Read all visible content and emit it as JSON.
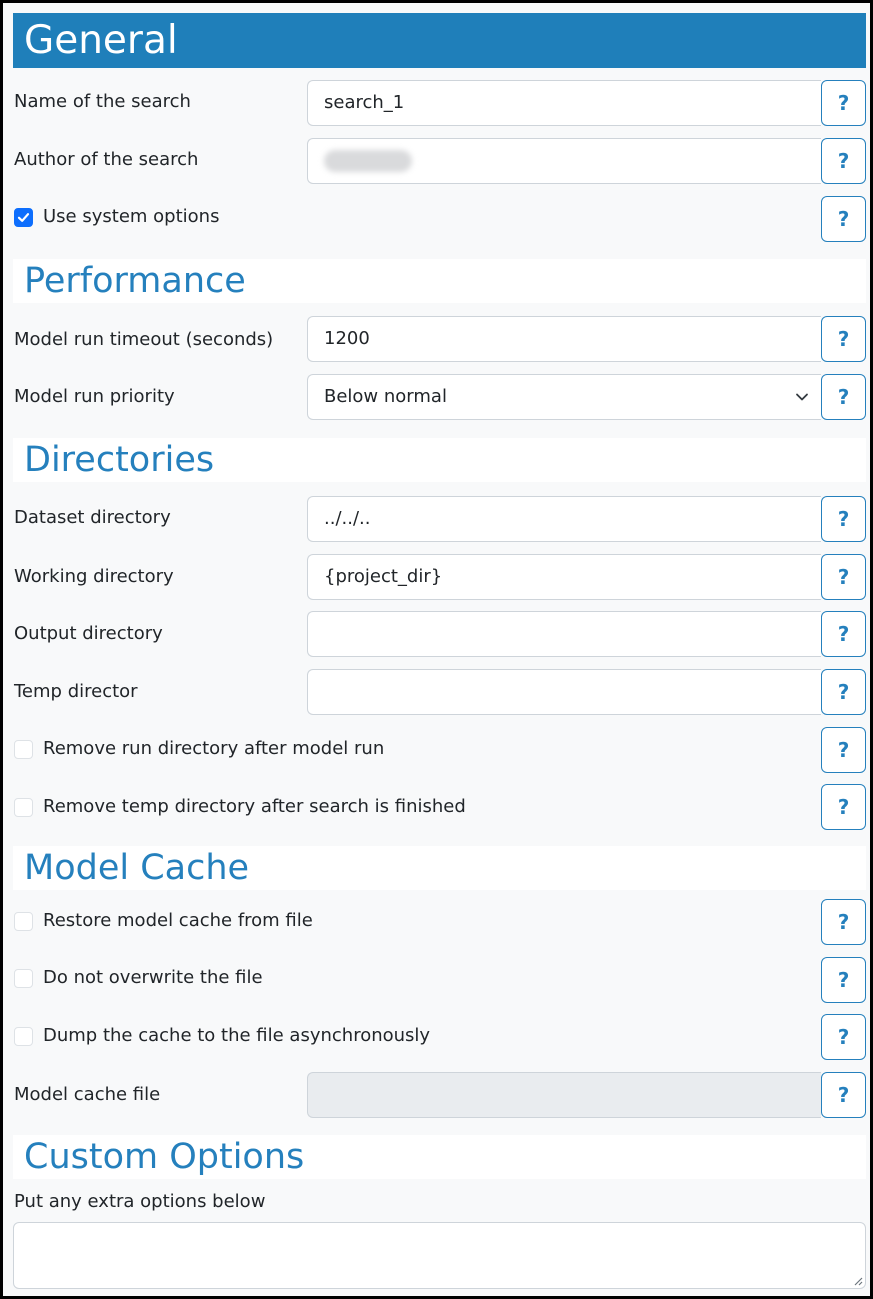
{
  "header": {
    "title": "General"
  },
  "general": {
    "name_label": "Name of the search",
    "name_value": "search_1",
    "author_label": "Author of the search",
    "use_system_options_label": "Use system options",
    "use_system_options_checked": true
  },
  "performance": {
    "title": "Performance",
    "timeout_label": "Model run timeout (seconds)",
    "timeout_value": "1200",
    "priority_label": "Model run priority",
    "priority_value": "Below normal"
  },
  "directories": {
    "title": "Directories",
    "dataset_label": "Dataset directory",
    "dataset_value": "../../..",
    "working_label": "Working directory",
    "working_value": "{project_dir}",
    "output_label": "Output directory",
    "output_value": "",
    "temp_label": "Temp director",
    "temp_value": "",
    "remove_run_label": "Remove run directory after model run",
    "remove_temp_label": "Remove temp directory after search is finished"
  },
  "model_cache": {
    "title": "Model Cache",
    "restore_label": "Restore model cache from file",
    "no_overwrite_label": "Do not overwrite the file",
    "dump_async_label": "Dump the cache to the file asynchronously",
    "cache_file_label": "Model cache file",
    "cache_file_value": ""
  },
  "custom_options": {
    "title": "Custom Options",
    "extra_label": "Put any extra options below",
    "extra_value": ""
  },
  "help": {
    "glyph": "?"
  },
  "colors": {
    "header_bg": "#1f7fba",
    "accent": "#2580bd",
    "checkbox_checked": "#0d6efd"
  }
}
